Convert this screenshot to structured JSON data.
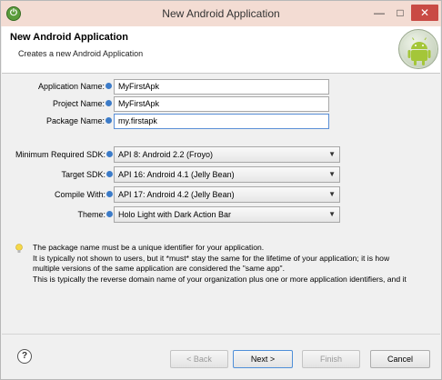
{
  "window": {
    "title": "New Android Application",
    "app_icon_glyph": "⏻",
    "minimize_glyph": "—",
    "maximize_glyph": "□",
    "close_glyph": "✕"
  },
  "header": {
    "title": "New Android Application",
    "subtitle": "Creates a new Android Application"
  },
  "form": {
    "application_name": {
      "label": "Application Name:",
      "value": "MyFirstApk"
    },
    "project_name": {
      "label": "Project Name:",
      "value": "MyFirstApk"
    },
    "package_name": {
      "label": "Package Name:",
      "value": "my.firstapk"
    },
    "min_sdk": {
      "label": "Minimum Required SDK:",
      "value": "API 8: Android 2.2 (Froyo)"
    },
    "target_sdk": {
      "label": "Target SDK:",
      "value": "API 16: Android 4.1 (Jelly Bean)"
    },
    "compile_with": {
      "label": "Compile With:",
      "value": "API 17: Android 4.2 (Jelly Bean)"
    },
    "theme": {
      "label": "Theme:",
      "value": "Holo Light with Dark Action Bar"
    }
  },
  "note": {
    "lines": [
      "The package name must be a unique identifier for your application.",
      "It is typically not shown to users, but it *must* stay the same for the lifetime of your application; it is how",
      "multiple versions of the same application are considered the \"same app\".",
      "This is typically the reverse domain name of your organization plus one or more application identifiers, and it"
    ]
  },
  "footer": {
    "help_glyph": "?",
    "back_label": "< Back",
    "next_label": "Next >",
    "finish_label": "Finish",
    "cancel_label": "Cancel"
  },
  "colors": {
    "titlebar": "#f3dcd3",
    "close_button": "#c94a44",
    "info_icon": "#3c7bc8",
    "android_green": "#a4c639"
  }
}
